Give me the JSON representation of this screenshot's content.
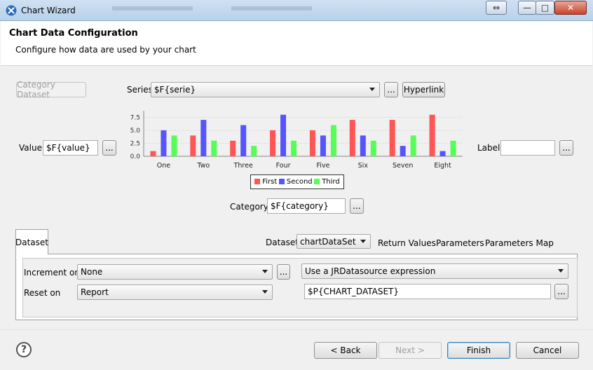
{
  "window": {
    "title": "Chart Wizard",
    "bg_tabs": [
      "1",
      "2"
    ]
  },
  "header": {
    "title": "Chart Data Configuration",
    "description": "Configure how data are used by your chart"
  },
  "category_dataset_button": "Category Dataset",
  "series": {
    "label": "Series",
    "value": "$F{serie}",
    "ellipsis": "...",
    "hyperlink": "Hyperlink"
  },
  "value": {
    "label": "Value",
    "value": "$F{value}",
    "ellipsis": "..."
  },
  "label": {
    "label": "Label",
    "value": "",
    "ellipsis": "..."
  },
  "category": {
    "label": "Category",
    "value": "$F{category}",
    "ellipsis": "..."
  },
  "chart_data": {
    "type": "bar",
    "categories": [
      "One",
      "Two",
      "Three",
      "Four",
      "Five",
      "Six",
      "Seven",
      "Eight"
    ],
    "series": [
      {
        "name": "First",
        "color": "#ff5555",
        "values": [
          1,
          4,
          3,
          5,
          5,
          7,
          7,
          8
        ]
      },
      {
        "name": "Second",
        "color": "#5555ff",
        "values": [
          5,
          7,
          6,
          8,
          4,
          4,
          2,
          1
        ]
      },
      {
        "name": "Third",
        "color": "#55ff55",
        "values": [
          4,
          3,
          2,
          3,
          6,
          3,
          4,
          3
        ]
      }
    ],
    "yticks": [
      "0.0",
      "2.5",
      "5.0",
      "7.5"
    ],
    "ylim": [
      0,
      8.5
    ],
    "legend_placement": "bottom"
  },
  "tabs": {
    "dataset": "Dataset",
    "dataset_label": "Dataset",
    "dataset_value": "chartDataSet",
    "return_values": "Return Values",
    "parameters": "Parameters",
    "parameters_map": "Parameters Map"
  },
  "dataset_panel": {
    "increment_label": "Increment on",
    "increment_value": "None",
    "ellipsis": "...",
    "reset_label": "Reset on",
    "reset_value": "Report",
    "source_value": "Use a JRDatasource expression",
    "expression_value": "$P{CHART_DATASET}"
  },
  "footer": {
    "help": "?",
    "back": "< Back",
    "next": "Next >",
    "finish": "Finish",
    "cancel": "Cancel"
  }
}
